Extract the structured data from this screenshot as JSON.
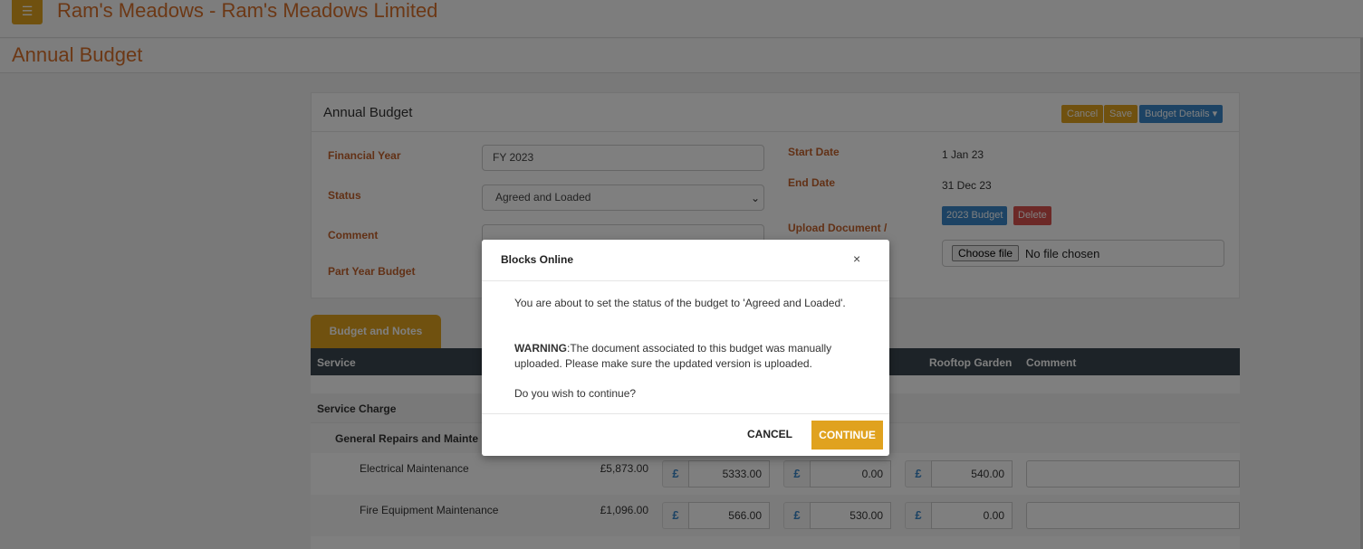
{
  "header": {
    "menu_icon": "hamburger-icon",
    "app_title": "Ram's Meadows - Ram's Meadows Limited",
    "page_title": "Annual Budget"
  },
  "card": {
    "title": "Annual Budget",
    "buttons": {
      "cancel": "Cancel",
      "save": "Save",
      "budget_details": "Budget Details ▾"
    },
    "labels": {
      "financial_year": "Financial Year",
      "status": "Status",
      "comment": "Comment",
      "part_year": "Part Year Budget",
      "start_date": "Start Date",
      "end_date": "End Date",
      "upload": "Upload Document /"
    },
    "financial_year_value": "FY 2023",
    "status_value": "Agreed and Loaded",
    "start_date_value": "1 Jan 23",
    "end_date_value": "31 Dec 23",
    "doc_tag": "2023 Budget",
    "delete_tag": "Delete",
    "file_button": "Choose file",
    "file_text": "No file chosen"
  },
  "tabs": {
    "budget_notes": "Budget and Notes"
  },
  "table": {
    "headers": {
      "service": "Service",
      "rooftop_garden": "Rooftop Garden",
      "comment": "Comment"
    },
    "section": "Service Charge",
    "group": "General Repairs and Mainte",
    "currency_symbol": "£",
    "rows": [
      {
        "name": "Electrical Maintenance",
        "total": "£5,873.00",
        "v1": "5333.00",
        "v2": "0.00",
        "v3": "540.00"
      },
      {
        "name": "Fire Equipment Maintenance",
        "total": "£1,096.00",
        "v1": "566.00",
        "v2": "530.00",
        "v3": "0.00"
      }
    ]
  },
  "modal": {
    "title": "Blocks Online",
    "close": "×",
    "line1": "You are about to set the status of the budget to 'Agreed and Loaded'.",
    "warning_label": "WARNING",
    "warning_text": ":The document associated to this budget was manually uploaded. Please make sure the updated version is uploaded.",
    "question": "Do you wish to continue?",
    "cancel": "CANCEL",
    "continue": "CONTINUE"
  },
  "colors": {
    "accent": "#e0a21f",
    "brand_text": "#d9702b",
    "primary": "#3a87c8",
    "danger": "#d9534f",
    "table_header": "#3a4750"
  }
}
